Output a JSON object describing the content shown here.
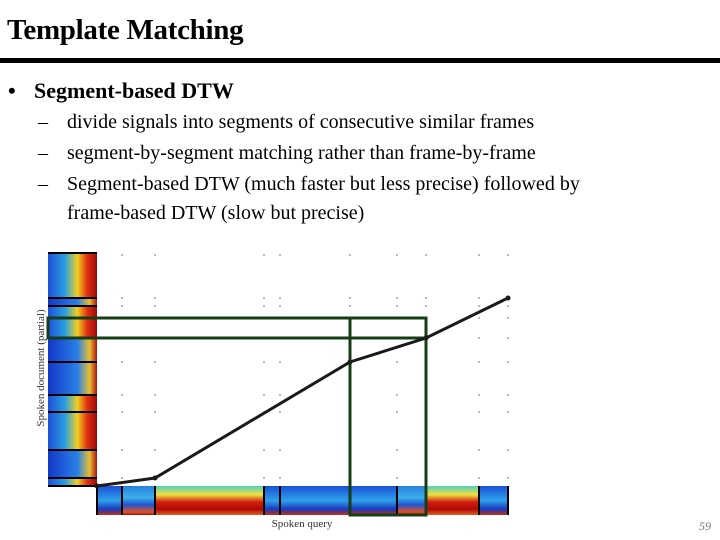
{
  "slide": {
    "title": "Template Matching",
    "bullet": {
      "marker": "•",
      "text": "Segment-based DTW",
      "sub_items": [
        {
          "marker": "–",
          "text": "divide signals into segments of  consecutive similar frames"
        },
        {
          "marker": "–",
          "text": "segment-by-segment matching rather than frame-by-frame"
        },
        {
          "marker": "–",
          "text": "Segment-based DTW (much faster but less precise) followed by",
          "continuation": "frame-based DTW (slow but precise)"
        }
      ]
    },
    "page_number": "59"
  },
  "figure": {
    "x_axis_label": "Spoken query",
    "y_axis_label": "Spoken document (partial)",
    "query_segments": 9,
    "document_segments": 9,
    "warping_path": [
      [
        0,
        0
      ],
      [
        2,
        1
      ],
      [
        5,
        5
      ],
      [
        7,
        6
      ],
      [
        9,
        9
      ]
    ],
    "highlighted_query_segment": [
      5,
      7
    ],
    "highlighted_document_segment": [
      6,
      7
    ],
    "colors": {
      "path": "#1a1a1a",
      "highlight": "#173d17",
      "grid_dot": "#888888"
    }
  }
}
